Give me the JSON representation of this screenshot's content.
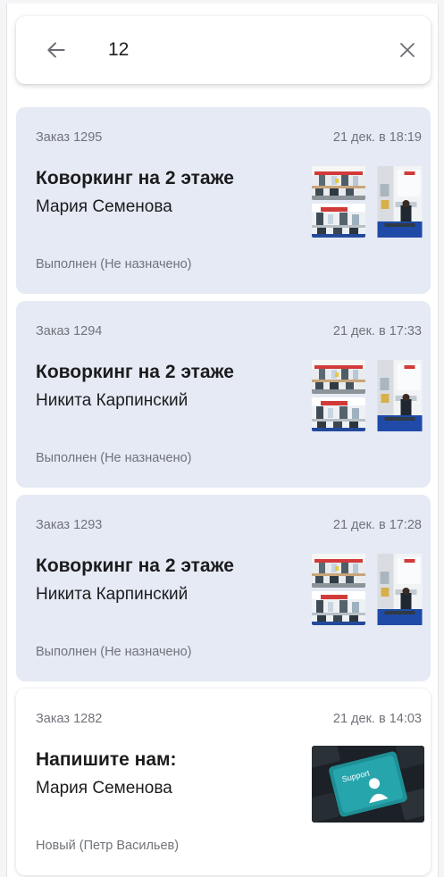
{
  "search": {
    "value": "12",
    "back_icon": "arrow-left-icon",
    "clear_icon": "close-icon"
  },
  "orders": [
    {
      "number": "Заказ 1295",
      "date": "21 дек. в 18:19",
      "title": "Коворкинг на 2 этаже",
      "author": "Мария Семенова",
      "status": "Выполнен (Не назначено)",
      "attachment": "office-photos"
    },
    {
      "number": "Заказ 1294",
      "date": "21 дек. в 17:33",
      "title": "Коворкинг на 2 этаже",
      "author": "Никита Карпинский",
      "status": "Выполнен (Не назначено)",
      "attachment": "office-photos"
    },
    {
      "number": "Заказ 1293",
      "date": "21 дек. в 17:28",
      "title": "Коворкинг на 2 этаже",
      "author": "Никита Карпинский",
      "status": "Выполнен (Не назначено)",
      "attachment": "office-photos"
    },
    {
      "number": "Заказ 1282",
      "date": "21 дек. в 14:03",
      "title": "Напишите нам:",
      "author": "Мария Семенова",
      "status": "Новый (Петр Васильев)",
      "attachment": "support-keyboard-photo",
      "support_key_label": "Support"
    }
  ],
  "colors": {
    "read_card_bg": "#e5eaf4",
    "new_card_bg": "#ffffff",
    "muted_text": "#707379",
    "primary_text": "#1c1c1e"
  }
}
